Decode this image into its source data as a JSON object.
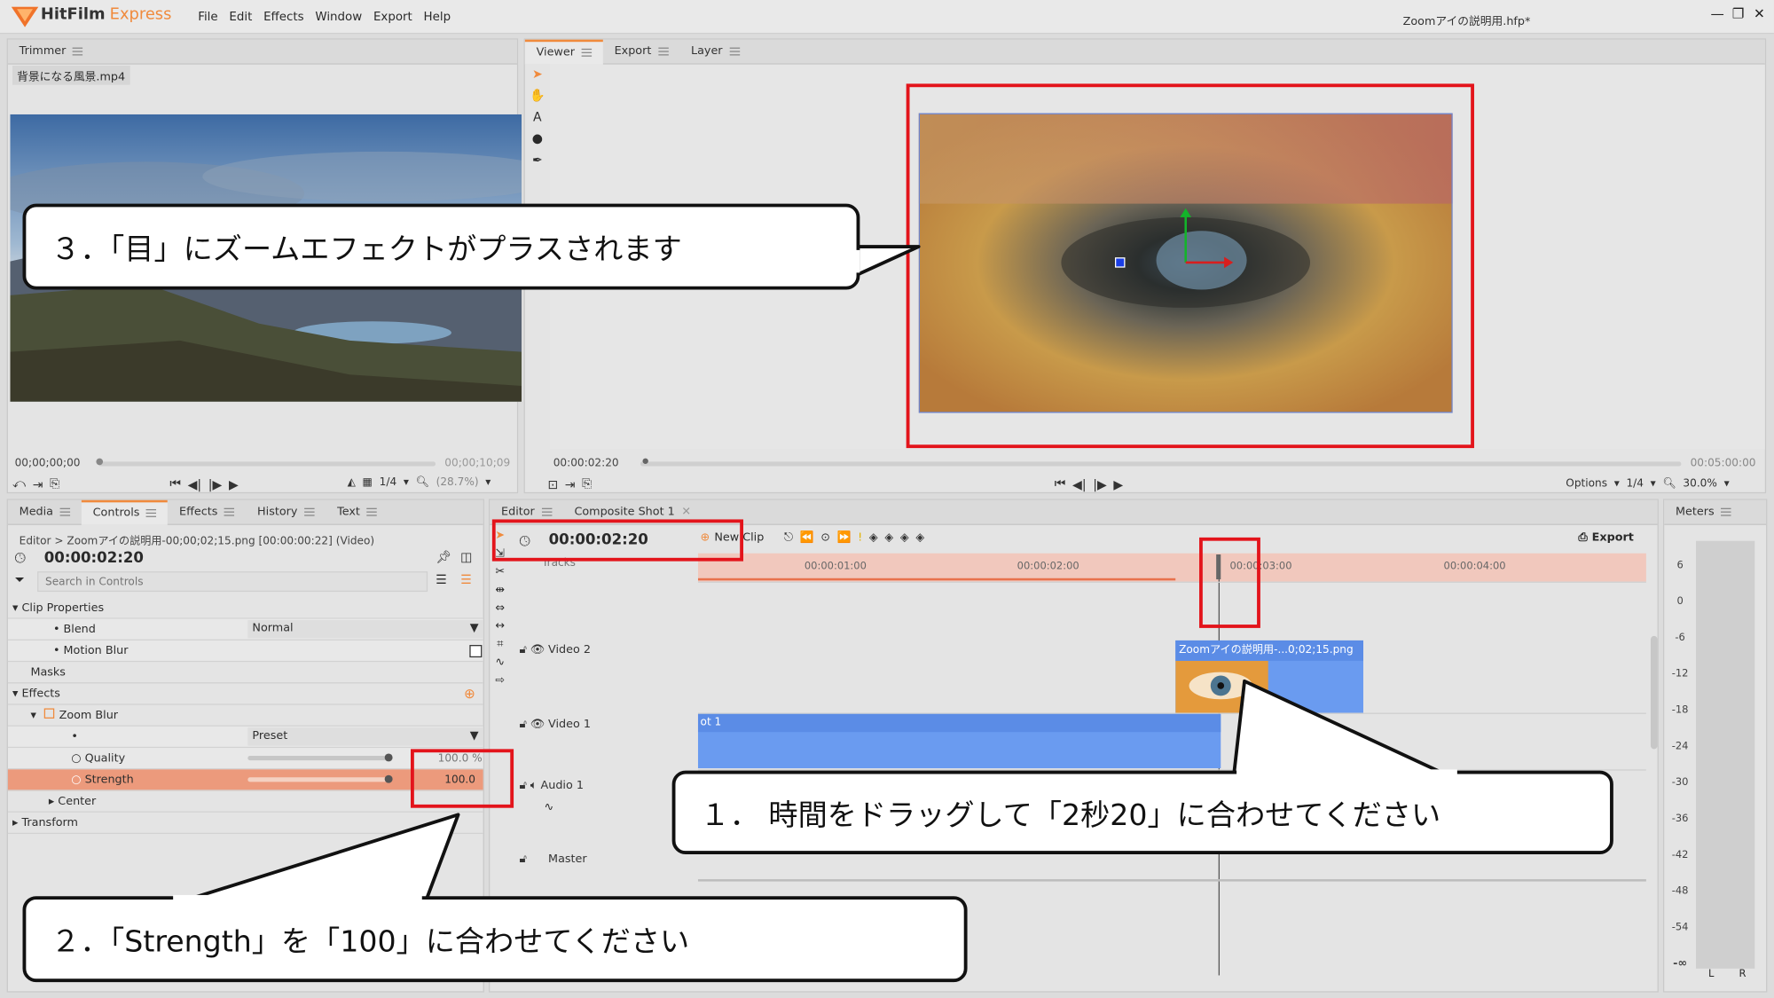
{
  "app": {
    "name": "HitFilm",
    "edition": "Express",
    "project_title": "Zoomアイの説明用.hfp*",
    "window_controls": [
      "—",
      "❐",
      "✕"
    ]
  },
  "menu": [
    "File",
    "Edit",
    "Effects",
    "Window",
    "Export",
    "Help"
  ],
  "trimmer": {
    "tab": "Trimmer",
    "file": "背景になる風景.mp4",
    "tc_start": "00;00;00;00",
    "tc_end": "00;00;10;09",
    "zoom": "1/4",
    "scale": "(28.7%)"
  },
  "viewer": {
    "tabs": [
      "Viewer",
      "Export",
      "Layer"
    ],
    "tc": "00:00:02:20",
    "tc_end": "00:05:00:00",
    "options": "Options",
    "zoom": "1/4",
    "scale": "30.0%"
  },
  "controls_panel": {
    "tabs": [
      "Media",
      "Controls",
      "Effects",
      "History",
      "Text"
    ],
    "path": "Editor > Zoomアイの説明用-00;00;02;15.png [00:00:00:22] (Video)",
    "time": "00:00:02:20",
    "search_placeholder": "Search in Controls",
    "rows": {
      "clip_properties": "Clip Properties",
      "blend": "Blend",
      "blend_value": "Normal",
      "motion_blur": "Motion Blur",
      "masks": "Masks",
      "effects": "Effects",
      "zoom_blur": "Zoom Blur",
      "preset": "Preset",
      "quality": "Quality",
      "quality_value": "100.0 %",
      "strength": "Strength",
      "strength_value": "100.0",
      "center": "Center",
      "transform": "Transform"
    }
  },
  "editor": {
    "tabs": [
      "Editor",
      "Composite Shot 1"
    ],
    "time": "00:00:02:20",
    "new_clip": "New Clip",
    "export": "Export",
    "tracks_label": "Tracks",
    "ruler": [
      "00:00:01:00",
      "00:00:02:00",
      "00:00:03:00",
      "00:00:04:00"
    ],
    "tracks": [
      "Video 2",
      "Video 1",
      "Audio 1",
      "Master"
    ],
    "clip_v2": "Zoomアイの説明用-...0;02;15.png",
    "clip_v1": "ot 1"
  },
  "meters": {
    "tab": "Meters",
    "scale": [
      "6",
      "0",
      "-6",
      "-12",
      "-18",
      "-24",
      "-30",
      "-36",
      "-42",
      "-48",
      "-54",
      "-∞"
    ],
    "channels": [
      "L",
      "R"
    ]
  },
  "callouts": {
    "step3": "３．「目」にズームエフェクトがプラスされます",
    "step1": "１． 時間をドラッグして「2秒20」に合わせてください",
    "step2": "２．「Strength」を「100」に合わせてください"
  },
  "colors": {
    "accent": "#f08a3c",
    "highlight": "#e3141b",
    "clip": "#6a9bf0"
  }
}
